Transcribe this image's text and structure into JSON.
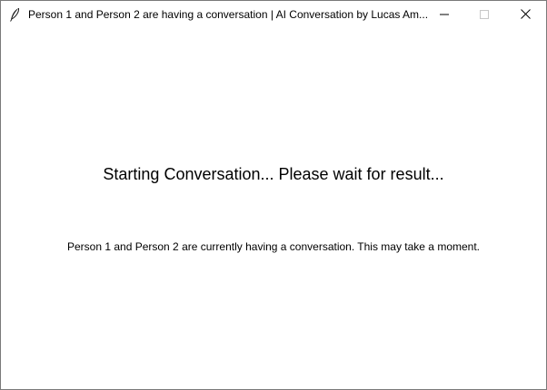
{
  "window": {
    "title": "Person 1 and Person 2 are having a conversation | AI Conversation by Lucas Am...",
    "app_icon": "feather-icon",
    "controls": {
      "minimize_icon": "minimize-icon",
      "maximize_icon": "maximize-icon",
      "close_icon": "close-icon"
    }
  },
  "main": {
    "heading": "Starting Conversation... Please wait for result...",
    "message": "Person 1 and Person 2 are currently having a conversation. This may take a moment."
  },
  "colors": {
    "background": "#ffffff",
    "text": "#000000",
    "border": "#7a7a7a"
  }
}
